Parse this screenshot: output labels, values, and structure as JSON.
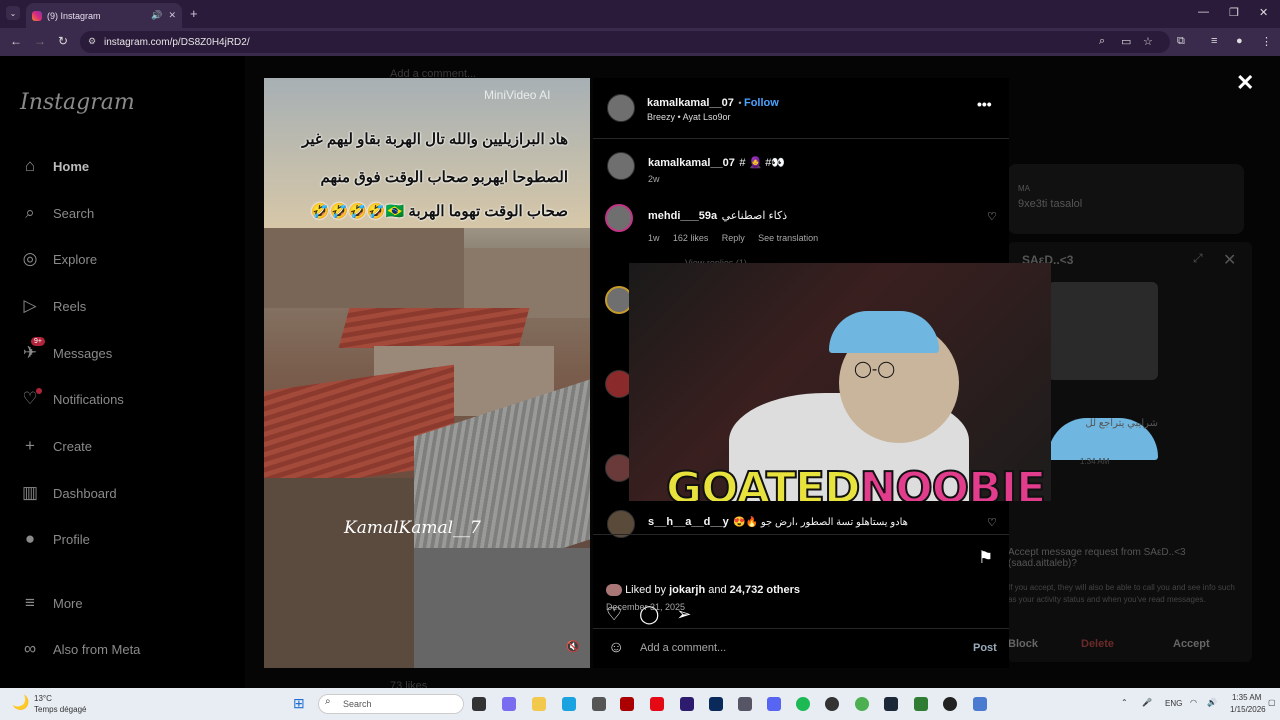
{
  "browser": {
    "tab_title": "(9) Instagram",
    "url": "instagram.com/p/DS8Z0H4jRD2/"
  },
  "sidebar": {
    "logo": "Instagram",
    "items": [
      {
        "label": "Home",
        "icon": "home-icon"
      },
      {
        "label": "Search",
        "icon": "search-icon"
      },
      {
        "label": "Explore",
        "icon": "compass-icon"
      },
      {
        "label": "Reels",
        "icon": "reels-icon"
      },
      {
        "label": "Messages",
        "icon": "messenger-icon",
        "badge": "9+"
      },
      {
        "label": "Notifications",
        "icon": "heart-icon"
      },
      {
        "label": "Create",
        "icon": "plus-icon"
      },
      {
        "label": "Dashboard",
        "icon": "chart-icon"
      },
      {
        "label": "Profile",
        "icon": "avatar-icon"
      },
      {
        "label": "More",
        "icon": "menu-icon"
      },
      {
        "label": "Also from Meta",
        "icon": "meta-icon"
      }
    ]
  },
  "background": {
    "feed_text_top": "Add a comment...",
    "dm_preview": {
      "name": "MA",
      "message": "9xe3ti tasalol"
    },
    "chat": {
      "title": "SAεD..<3",
      "caption": "شرايبي يتراجع لل",
      "time": "1:34 AM",
      "request": "Accept message request from SAεD..<3 (saad.aittaleb)?",
      "note": "If you accept, they will also be able to call you and see info such as your activity status and when you've read messages.",
      "block": "Block",
      "delete": "Delete",
      "accept": "Accept"
    },
    "likes_text": "73 likes"
  },
  "video": {
    "watermark": "MiniVideo AI",
    "lines": [
      "هاد البرازيليين والله تال الهربة بقاو ليهم غير",
      "الصطوحا ايهربو صحاب الوقت فوق منهم",
      "صحاب الوقت تهوما الهربة 🇧🇷🤣🤣🤣🤣"
    ],
    "signature": "KamalKamal__7"
  },
  "post": {
    "author": "kamalkamal__07",
    "follow": "Follow",
    "audio": "Breezy • Ayat Lso9or",
    "caption_author": "kamalkamal__07",
    "caption_text": "# 🧕 #👀",
    "caption_time": "2w",
    "comments": [
      {
        "user": "mehdi___59a",
        "text": "ذكاء اصطناعي",
        "time": "1w",
        "likes": "162 likes",
        "reply": "Reply",
        "translate": "See translation",
        "view_replies": "View replies (1)"
      },
      {
        "user": "s__h__a__d__y",
        "text": "😍🔥 هادو يستاهلو تسة الصطور ،ارض جو"
      }
    ],
    "liked_by_user": "jokarjh",
    "liked_others": "24,732 others",
    "liked_prefix": "Liked by",
    "liked_and": "and",
    "date": "December 31, 2025",
    "comment_placeholder": "Add a comment...",
    "post_button": "Post"
  },
  "overlay": {
    "brand_part1": "GOATED",
    "brand_part2": "NOOBIE"
  },
  "taskbar": {
    "weather_temp": "13°C",
    "weather_desc": "Temps dégagé",
    "search": "Search",
    "lang": "ENG",
    "time": "1:35 AM",
    "date": "1/15/2026"
  }
}
